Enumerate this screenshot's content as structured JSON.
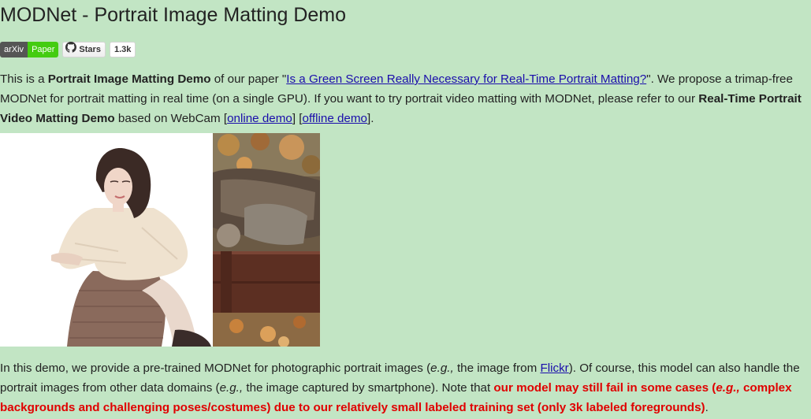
{
  "header": {
    "title": "MODNet - Portrait Image Matting Demo"
  },
  "badges": {
    "arxiv_left": "arXiv",
    "arxiv_right": "Paper",
    "stars_label": "Stars",
    "stars_count": "1.3k"
  },
  "intro": {
    "t1": "This is a ",
    "b1": "Portrait Image Matting Demo",
    "t2": " of our paper \"",
    "paper_link": "Is a Green Screen Really Necessary for Real-Time Portrait Matting?",
    "t3": "\". We propose a trimap-free MODNet for portrait matting in real time (on a single GPU). If you want to try portrait video matting with MODNet, please refer to our ",
    "b2": "Real-Time Portrait Video Matting Demo",
    "t4": " based on WebCam [",
    "online_link": "online demo",
    "t5": "] [",
    "offline_link": "offline demo",
    "t6": "]."
  },
  "demo": {
    "t1": "In this demo, we provide a pre-trained MODNet for photographic portrait images (",
    "eg1": "e.g.,",
    "t2": " the image from ",
    "flickr_link": "Flickr",
    "t3": "). Of course, this model can also handle the portrait images from other data domains (",
    "eg2": "e.g.,",
    "t4": " the image captured by smartphone). Note that ",
    "r1": "our model may still fail in some cases (",
    "eg3": "e.g.,",
    "r2": " complex backgrounds and challenging poses/costumes) due to our relatively small labeled training set (only 3k labeled foregrounds)",
    "t5": "."
  },
  "colors": {
    "page_bg": "#c2e5c4",
    "link": "#1a0dab",
    "warning": "#e00000"
  },
  "icons": {
    "github": "github-icon"
  }
}
